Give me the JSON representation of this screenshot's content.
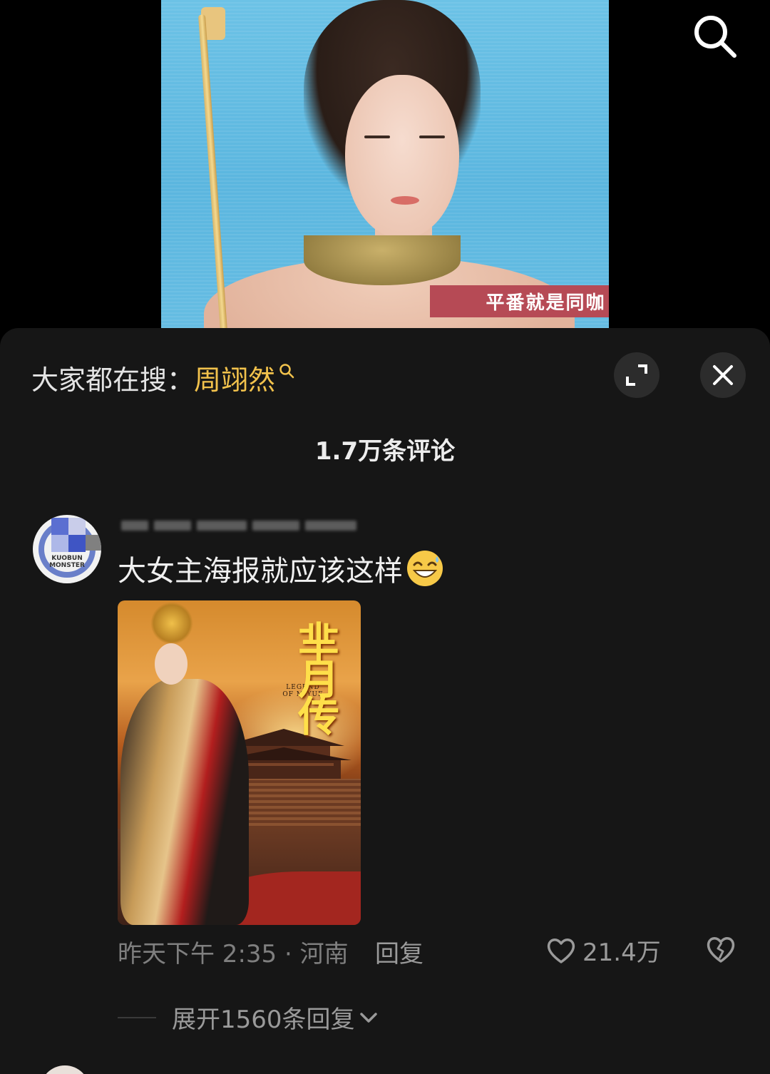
{
  "video": {
    "caption": "平番就是同咖"
  },
  "panel": {
    "trending_prefix": "大家都在搜：",
    "trending_query": "周翊然",
    "comment_count": "1.7万条评论"
  },
  "comment": {
    "text": "大女主海报就应该这样",
    "emoji": "grinning-sweat-emoji",
    "avatar_text": "KUOBUN MONSTER",
    "poster": {
      "title": "芈月传",
      "subtitle": "LEGEND OF MIYUE"
    },
    "time_location": "昨天下午 2:35 · 河南",
    "reply_label": "回复",
    "like_count": "21.4万",
    "expand_label": "展开1560条回复"
  },
  "icons": {
    "search": "search-icon",
    "expand": "expand-icon",
    "close": "close-icon",
    "like": "heart-icon",
    "dislike": "broken-heart-icon",
    "chevron": "chevron-down-icon"
  },
  "colors": {
    "panel_bg": "#161616",
    "trending_accent": "#f2c24c",
    "caption_bg": "#b64a55",
    "muted_text": "#9a9a9a"
  }
}
